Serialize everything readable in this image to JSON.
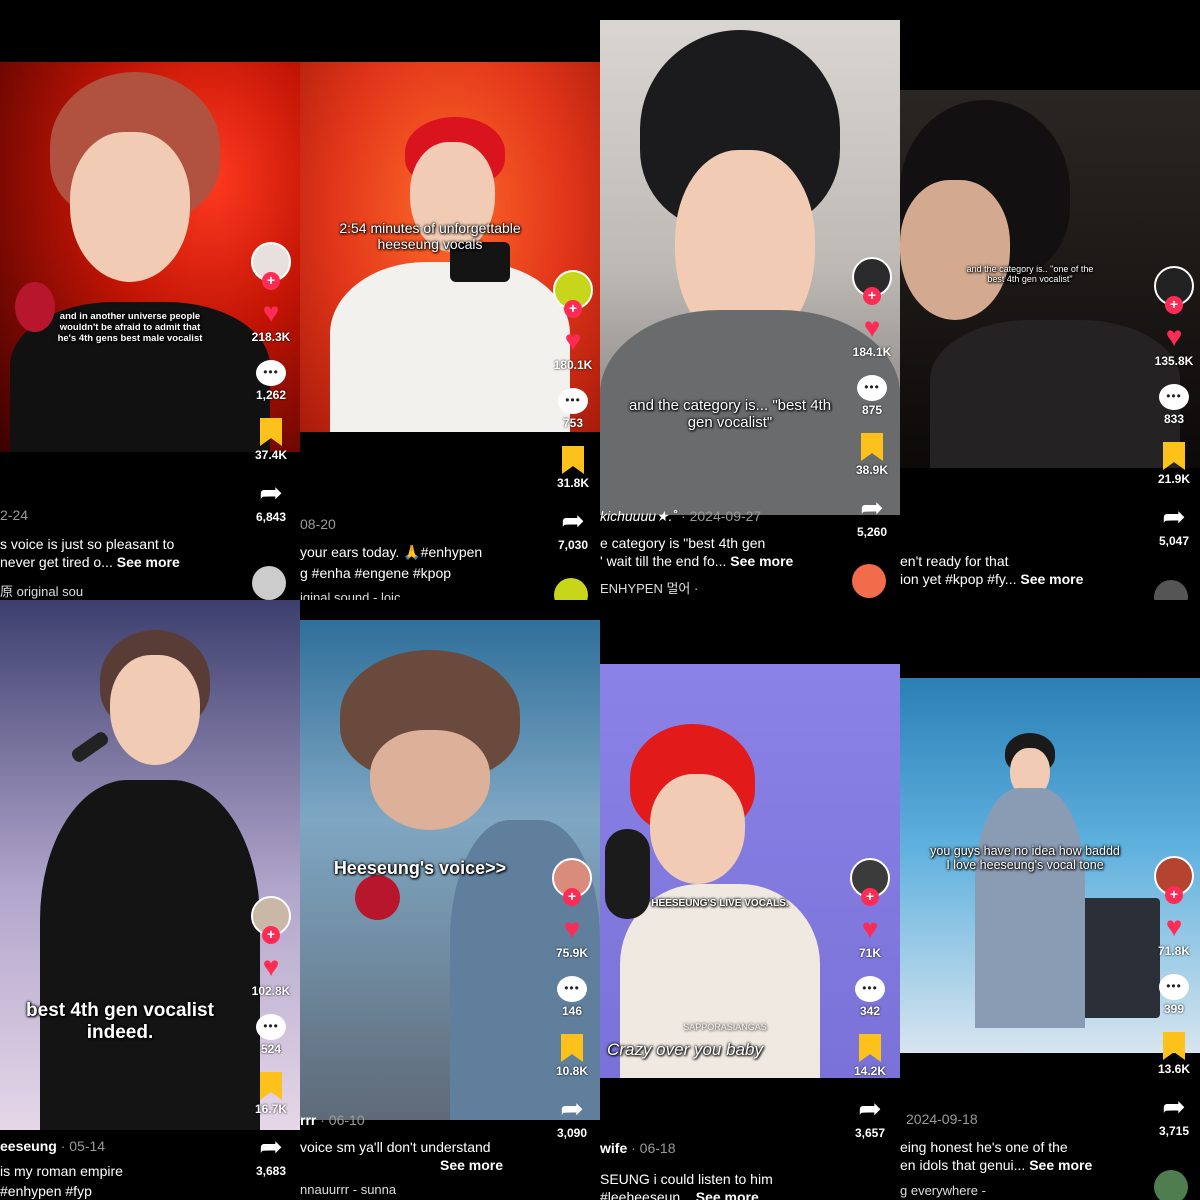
{
  "panels": [
    {
      "overlay": "and in another universe people wouldn't be afraid to admit that he's 4th gens best male vocalist",
      "likes": "218.3K",
      "comments": "1,262",
      "saves": "37.4K",
      "shares": "6,843",
      "date": "2-24",
      "caption": "s voice is just so pleasant to",
      "caption2": " never get tired o...",
      "see_more": "See more",
      "sound": "原   original sou"
    },
    {
      "overlay": "2:54 minutes of unforgettable heeseung vocals",
      "likes": "180.1K",
      "comments": "753",
      "saves": "31.8K",
      "shares": "7,030",
      "date": "08-20",
      "caption": "your ears today. 🙏#enhypen",
      "caption2": "g #enha #engene #kpop",
      "sound": "iginal sound - loic"
    },
    {
      "overlay": "and the category is... \"best 4th gen vocalist\"",
      "likes": "184.1K",
      "comments": "875",
      "saves": "38.9K",
      "shares": "5,260",
      "user": "kichuuuu★.˚",
      "date": "· 2024-09-27",
      "caption": "e category is \"best 4th gen",
      "caption2": "' wait till the end fo...",
      "see_more": "See more",
      "sound": "ENHYPEN    멀어 ·"
    },
    {
      "overlay": "and the category is.. \"one of the best 4th gen vocalist\"",
      "likes": "135.8K",
      "comments": "833",
      "saves": "21.9K",
      "shares": "5,047",
      "caption": "en't ready for that",
      "caption2": "ion yet #kpop #fy...",
      "see_more": "See more"
    },
    {
      "overlay": "best 4th gen vocalist indeed.",
      "likes": "102.8K",
      "comments": "524",
      "saves": "16.7K",
      "shares": "3,683",
      "user": "eeseung",
      "date": "· 05-14",
      "caption": "is my roman empire",
      "caption2": "#enhypen #fyp"
    },
    {
      "overlay": "Heeseung's voice>>",
      "likes": "75.9K",
      "comments": "146",
      "saves": "10.8K",
      "shares": "3,090",
      "user": "rrr",
      "date": "· 06-10",
      "caption": "voice sm ya'll don't understand",
      "see_more": "See more",
      "sound": "nnauurrr - sunna"
    },
    {
      "overlay": "HEESEUNG'S LIVE VOCALS.",
      "overlay2": "Crazy over you baby",
      "watermark": "SAPPORASIANGAS",
      "likes": "71K",
      "comments": "342",
      "saves": "14.2K",
      "shares": "3,657",
      "user": "wife",
      "date": "· 06-18",
      "caption": "SEUNG i could listen to him",
      "caption2": "#leeheeseun...",
      "see_more": "See more"
    },
    {
      "overlay": "you guys have no idea how baddd I love heeseung's vocal tone",
      "likes": "71.8K",
      "comments": "399",
      "saves": "13.6K",
      "shares": "3,715",
      "date": "2024-09-18",
      "caption": "eing honest he's one of the",
      "caption2": "en idols that genui...",
      "see_more": "See more",
      "sound": "g everywhere -"
    }
  ],
  "colors": {
    "like": "#fe2c55",
    "save": "#fcc21b",
    "follow": "#fe2c55"
  },
  "icons": [
    "heart-icon",
    "comment-icon",
    "bookmark-icon",
    "share-icon",
    "follow-plus-icon"
  ]
}
